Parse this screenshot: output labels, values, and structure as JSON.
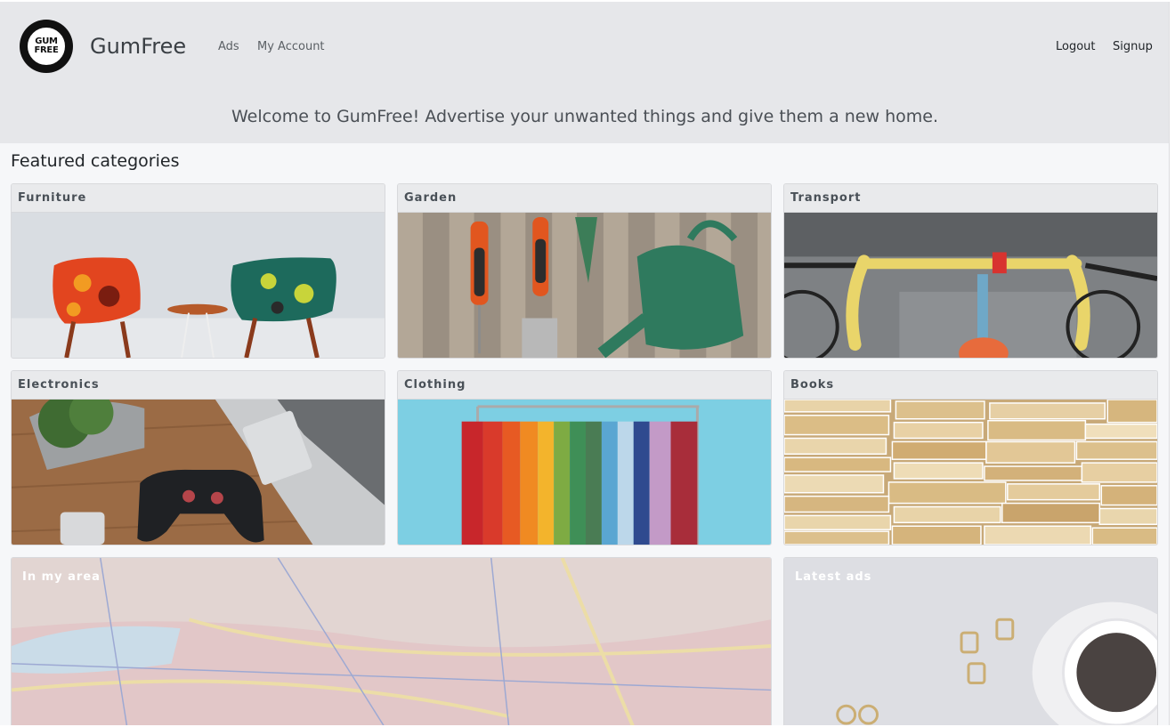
{
  "app": {
    "brand": "GumFree",
    "logo_text_top": "GUM",
    "logo_text_bottom": "FREE"
  },
  "nav": {
    "left": [
      {
        "label": "Ads"
      },
      {
        "label": "My Account"
      }
    ],
    "right": [
      {
        "label": "Logout"
      },
      {
        "label": "Signup"
      }
    ]
  },
  "hero": {
    "welcome": "Welcome to GumFree! Advertise your unwanted things and give them a new home."
  },
  "featured": {
    "title": "Featured categories",
    "categories": [
      {
        "label": "Furniture",
        "icon": "chairs-photo"
      },
      {
        "label": "Garden",
        "icon": "garden-tools-photo"
      },
      {
        "label": "Transport",
        "icon": "bicycle-photo"
      },
      {
        "label": "Electronics",
        "icon": "laptop-controller-photo"
      },
      {
        "label": "Clothing",
        "icon": "clothes-rack-photo"
      },
      {
        "label": "Books",
        "icon": "book-stack-photo"
      }
    ],
    "wide": [
      {
        "label": "In my area",
        "icon": "map-photo"
      },
      {
        "label": "Latest ads",
        "icon": "coffee-desk-photo"
      }
    ]
  },
  "colors": {
    "header_bg": "#e6e7ea",
    "page_bg": "#f6f7f9",
    "card_head_bg": "#e9eaec",
    "text_dark": "#212529"
  }
}
